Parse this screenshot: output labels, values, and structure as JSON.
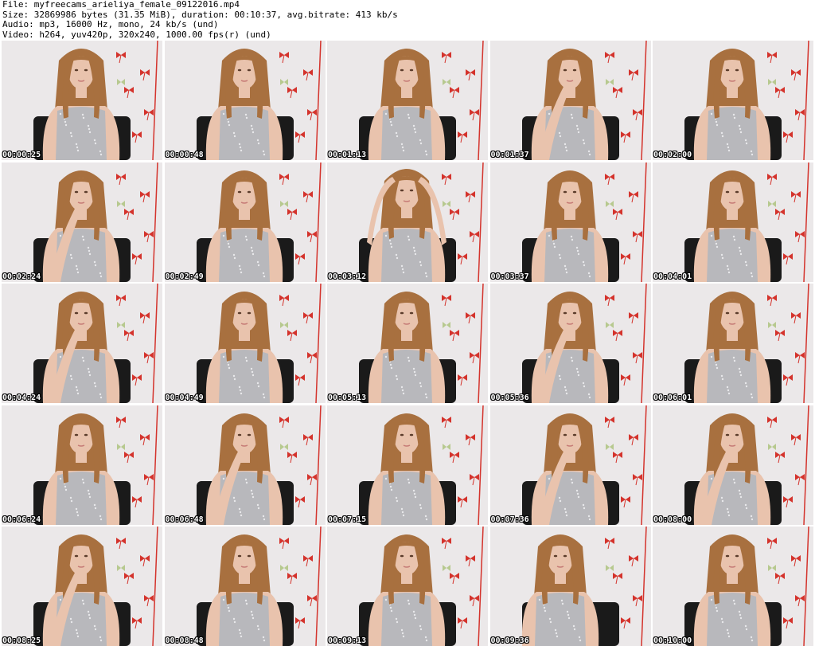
{
  "header": {
    "line1": "File: myfreecams_arieliya_female_09122016.mp4",
    "line2": "Size: 32869986 bytes (31.35 MiB), duration: 00:10:37, avg.bitrate: 413 kb/s",
    "line3": "Audio: mp3, 16000 Hz, mono, 24 kb/s (und)",
    "line4": "Video: h264, yuv420p, 320x240, 1000.00 fps(r) (und)"
  },
  "colors": {
    "wall": "#e8e4e5",
    "hair": "#a8703f",
    "skin": "#e9c3ad",
    "dress": "#b8b8bc",
    "chair": "#1a1a1a",
    "decor_red": "#d4332c",
    "decor_green": "#b7c98f"
  },
  "thumbnails": [
    {
      "time": "00:00:25",
      "pose": "neutral"
    },
    {
      "time": "00:00:48",
      "pose": "neutral"
    },
    {
      "time": "00:01:13",
      "pose": "neutral"
    },
    {
      "time": "00:01:37",
      "pose": "hand-chin"
    },
    {
      "time": "00:02:00",
      "pose": "neutral"
    },
    {
      "time": "00:02:24",
      "pose": "hand-chin"
    },
    {
      "time": "00:02:49",
      "pose": "neutral"
    },
    {
      "time": "00:03:12",
      "pose": "hands-hair"
    },
    {
      "time": "00:03:37",
      "pose": "neutral"
    },
    {
      "time": "00:04:01",
      "pose": "neutral"
    },
    {
      "time": "00:04:24",
      "pose": "hand-chin"
    },
    {
      "time": "00:04:49",
      "pose": "neutral"
    },
    {
      "time": "00:05:13",
      "pose": "neutral"
    },
    {
      "time": "00:05:36",
      "pose": "hand-chin"
    },
    {
      "time": "00:06:01",
      "pose": "neutral"
    },
    {
      "time": "00:06:24",
      "pose": "neutral"
    },
    {
      "time": "00:06:48",
      "pose": "hand-chin"
    },
    {
      "time": "00:07:15",
      "pose": "neutral"
    },
    {
      "time": "00:07:36",
      "pose": "hand-chin"
    },
    {
      "time": "00:08:00",
      "pose": "hand-chin"
    },
    {
      "time": "00:08:25",
      "pose": "hand-chin"
    },
    {
      "time": "00:08:48",
      "pose": "neutral"
    },
    {
      "time": "00:09:13",
      "pose": "neutral"
    },
    {
      "time": "00:09:36",
      "pose": "lean"
    },
    {
      "time": "00:10:00",
      "pose": "neutral"
    }
  ]
}
